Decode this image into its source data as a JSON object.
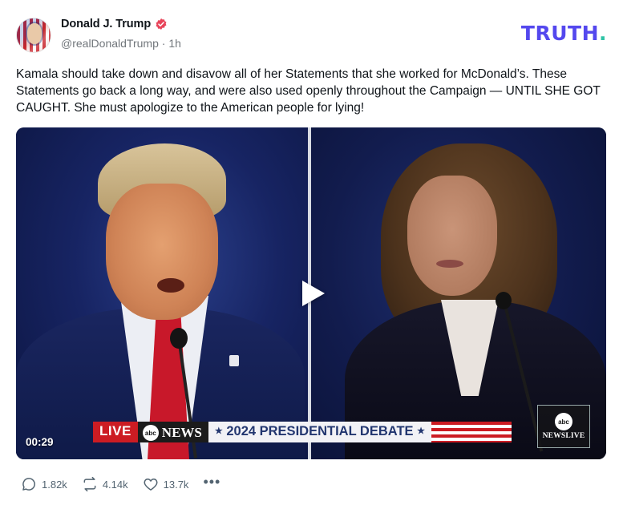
{
  "author": {
    "display_name": "Donald J. Trump",
    "handle": "@realDonaldTrump",
    "separator": "·",
    "time_ago": "1h"
  },
  "brand": {
    "logo_text": "TRUTH",
    "logo_dot": "."
  },
  "post": {
    "text": "Kamala should take down and disavow all of her Statements that she worked for McDonald’s. These Statements go back a long way, and were also used openly throughout the Campaign — UNTIL SHE GOT CAUGHT. She must apologize to the American people for lying!"
  },
  "video": {
    "duration": "00:29",
    "lower_third": {
      "live": "LIVE",
      "network": "NEWS",
      "network_badge": "abc",
      "star_left": "★",
      "headline": "2024 PRESIDENTIAL DEBATE",
      "star_right": "★"
    },
    "corner_logo": {
      "badge": "abc",
      "text": "NEWSLIVE"
    }
  },
  "actions": {
    "replies": "1.82k",
    "retruths": "4.14k",
    "likes": "13.7k",
    "more": "•••"
  },
  "colors": {
    "brand": "#5448ee",
    "brand_dot": "#2ec4a6",
    "verified": "#e8445a",
    "muted": "#536471",
    "live_red": "#cc1c23",
    "debate_navy": "#22366f"
  },
  "icons": {
    "verified": "verified-badge-icon",
    "reply": "comment-bubble-icon",
    "retruth": "repost-arrows-icon",
    "like": "heart-icon",
    "more": "ellipsis-icon",
    "play": "play-icon"
  }
}
